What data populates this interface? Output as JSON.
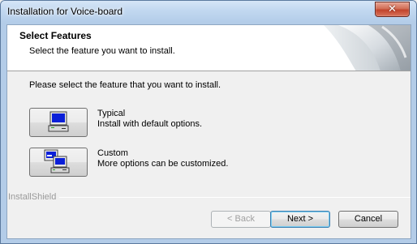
{
  "window": {
    "title": "Installation for Voice-board",
    "close_glyph": "✕"
  },
  "header": {
    "title": "Select Features",
    "subtitle": "Select the feature you want to install."
  },
  "main": {
    "prompt": "Please select the feature that you want to install.",
    "options": [
      {
        "name": "Typical",
        "description": "Install with default options.",
        "icon": "computer-icon"
      },
      {
        "name": "Custom",
        "description": "More options can be customized.",
        "icon": "custom-setup-icon"
      }
    ]
  },
  "footer": {
    "brand": "InstallShield",
    "back_label": "< Back",
    "next_label": "Next >",
    "cancel_label": "Cancel"
  },
  "colors": {
    "titlebar": "#c2d8f0",
    "close_button": "#c2432b",
    "dialog_background": "#f0f0f0",
    "default_button_border": "#3c7fb1"
  }
}
